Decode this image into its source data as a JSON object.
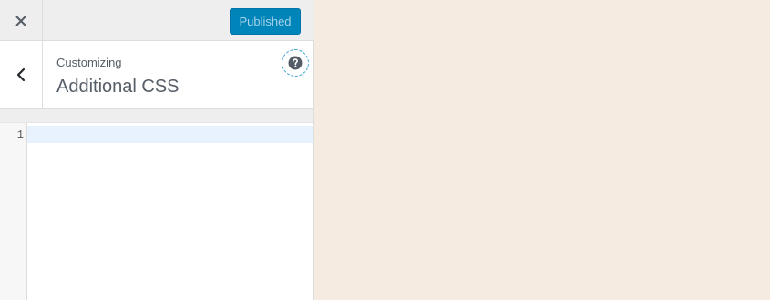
{
  "topbar": {
    "publish_label": "Published"
  },
  "header": {
    "customizing_label": "Customizing",
    "section_title": "Additional CSS"
  },
  "editor": {
    "line_numbers": [
      "1"
    ],
    "content": ""
  },
  "icons": {
    "close": "close-icon",
    "back": "chevron-left-icon",
    "help": "help-icon"
  },
  "colors": {
    "accent": "#0085ba",
    "preview_background": "#f5ebe0",
    "active_line": "#e8f2ff"
  }
}
